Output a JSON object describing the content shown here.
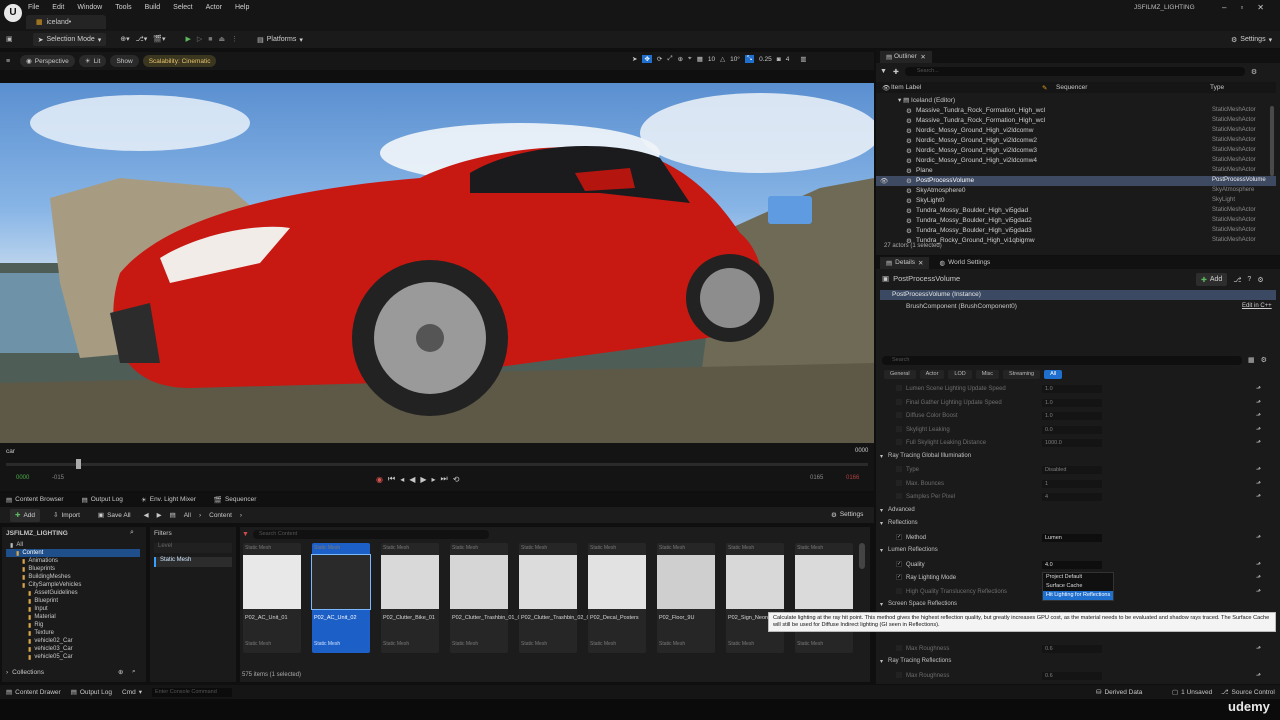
{
  "title_bar": {
    "menu": [
      "File",
      "Edit",
      "Window",
      "Tools",
      "Build",
      "Select",
      "Actor",
      "Help"
    ],
    "tab": "iceland•",
    "project": "JSFILMZ_LIGHTING"
  },
  "toolbar": {
    "selection_mode": "Selection Mode",
    "platforms": "Platforms",
    "settings": "Settings"
  },
  "viewport": {
    "perspective": "Perspective",
    "lit": "Lit",
    "show": "Show",
    "scalability": "Scalability: Cinematic",
    "grid_snap": "10",
    "rot_snap": "10°",
    "scale_snap": "0.25",
    "cam_speed": "4"
  },
  "sequencer": {
    "track": "car",
    "frame_end": "0000",
    "start": "0000",
    "minus": "-015",
    "end1": "0165",
    "end2": "0166"
  },
  "content_browser": {
    "tabs": [
      "Content Browser",
      "Output Log",
      "Env. Light Mixer",
      "Sequencer"
    ],
    "add": "Add",
    "import": "Import",
    "save_all": "Save All",
    "path": [
      "All",
      "Content"
    ],
    "settings": "Settings",
    "root": "JSFILMZ_LIGHTING",
    "tree": [
      "All",
      "Content",
      "Animations",
      "Blueprints",
      "BuildingMeshes",
      "CitySampleVehicles",
      "AssetGuidelines",
      "Blueprint",
      "Input",
      "Material",
      "Rig",
      "Texture",
      "vehicle02_Car",
      "vehicle03_Car",
      "vehicle05_Car"
    ],
    "collections": "Collections",
    "filters_label": "Filters",
    "filter_level": "Level",
    "filter_static": "Static Mesh",
    "search_placeholder": "Search Content",
    "items": [
      {
        "name": "P02_AC_Unit_01",
        "type": "Static Mesh"
      },
      {
        "name": "P02_AC_Unit_02",
        "type": "Static Mesh"
      },
      {
        "name": "P02_Clutter_Bike_01",
        "type": "Static Mesh"
      },
      {
        "name": "P02_Clutter_Trashbin_01_Open",
        "type": "Static Mesh"
      },
      {
        "name": "P02_Clutter_Trashbin_02_Open",
        "type": "Static Mesh"
      },
      {
        "name": "P02_Decal_Posters",
        "type": "Static Mesh"
      },
      {
        "name": "P02_Floor_9U",
        "type": "Static Mesh"
      },
      {
        "name": "P02_Sign_Neon_Arrow",
        "type": "Static Mesh"
      },
      {
        "name": "",
        "type": "Static Mesh"
      }
    ],
    "count": "575 items (1 selected)"
  },
  "status": {
    "content_drawer": "Content Drawer",
    "output_log": "Output Log",
    "cmd": "Cmd",
    "console_placeholder": "Enter Console Command",
    "derived": "Derived Data",
    "unsaved": "1 Unsaved",
    "source": "Source Control"
  },
  "outliner": {
    "title": "Outliner",
    "search_placeholder": "Search...",
    "col_label": "Item Label",
    "col_seq": "Sequencer",
    "col_type": "Type",
    "root": "Iceland (Editor)",
    "rows": [
      {
        "label": "Massive_Tundra_Rock_Formation_High_wcl",
        "type": "StaticMeshActor"
      },
      {
        "label": "Massive_Tundra_Rock_Formation_High_wcl",
        "type": "StaticMeshActor"
      },
      {
        "label": "Nordic_Mossy_Ground_High_vi2ldcomw",
        "type": "StaticMeshActor"
      },
      {
        "label": "Nordic_Mossy_Ground_High_vi2ldcomw2",
        "type": "StaticMeshActor"
      },
      {
        "label": "Nordic_Mossy_Ground_High_vi2ldcomw3",
        "type": "StaticMeshActor"
      },
      {
        "label": "Nordic_Mossy_Ground_High_vi2ldcomw4",
        "type": "StaticMeshActor"
      },
      {
        "label": "Plane",
        "type": "StaticMeshActor"
      },
      {
        "label": "PostProcessVolume",
        "type": "PostProcessVolume"
      },
      {
        "label": "SkyAtmosphere0",
        "type": "SkyAtmosphere"
      },
      {
        "label": "SkyLight0",
        "type": "SkyLight"
      },
      {
        "label": "Tundra_Mossy_Boulder_High_vi5gdad",
        "type": "StaticMeshActor"
      },
      {
        "label": "Tundra_Mossy_Boulder_High_vi5gdad2",
        "type": "StaticMeshActor"
      },
      {
        "label": "Tundra_Mossy_Boulder_High_vi5gdad3",
        "type": "StaticMeshActor"
      },
      {
        "label": "Tundra_Rocky_Ground_High_vi1qbigmw",
        "type": "StaticMeshActor"
      }
    ],
    "footer": "27 actors (1 selected)"
  },
  "details": {
    "tab1": "Details",
    "tab2": "World Settings",
    "object": "PostProcessVolume",
    "add": "Add",
    "instance": "PostProcessVolume (Instance)",
    "component": "BrushComponent (BrushComponent0)",
    "edit_cpp": "Edit in C++",
    "search_placeholder": "Search",
    "filters": [
      "General",
      "Actor",
      "LOD",
      "Misc",
      "Streaming",
      "All"
    ],
    "rows": [
      {
        "k": "Lumen Scene Lighting Update Speed",
        "v": "1.0"
      },
      {
        "k": "Final Gather Lighting Update Speed",
        "v": "1.0"
      },
      {
        "k": "Diffuse Color Boost",
        "v": "1.0"
      },
      {
        "k": "Skylight Leaking",
        "v": "0.0"
      },
      {
        "k": "Full Skylight Leaking Distance",
        "v": "1000.0"
      }
    ],
    "rtgi": "Ray Tracing Global Illumination",
    "rtgi_rows": [
      {
        "k": "Type",
        "v": "Disabled"
      },
      {
        "k": "Max. Bounces",
        "v": "1"
      },
      {
        "k": "Samples Per Pixel",
        "v": "4"
      }
    ],
    "advanced": "Advanced",
    "reflections": "Reflections",
    "method_label": "Method",
    "method_value": "Lumen",
    "lumen_reflections": "Lumen Reflections",
    "quality_label": "Quality",
    "quality_value": "4.0",
    "ray_lighting_label": "Ray Lighting Mode",
    "ray_lighting_value": "Surface Cache",
    "hq_translucency": "High Quality Translucency Reflections",
    "ssr": "Screen Space Reflections",
    "dropdown": [
      "Project Default",
      "Surface Cache",
      "Hit Lighting for Reflections"
    ],
    "tooltip": "Calculate lighting at the ray hit point.  This method gives the highest reflection quality, but greatly increases GPU cost, as the material needs to be evaluated and shadow rays traced.  The Surface Cache will still be used for Diffuse Indirect lighting (GI seen in Reflections).",
    "max_roughness_label": "Max Roughness",
    "max_roughness_value": "0.6",
    "rt_reflections": "Ray Tracing Reflections",
    "rt_max_roughness_value": "0.6"
  },
  "watermark": "udemy"
}
